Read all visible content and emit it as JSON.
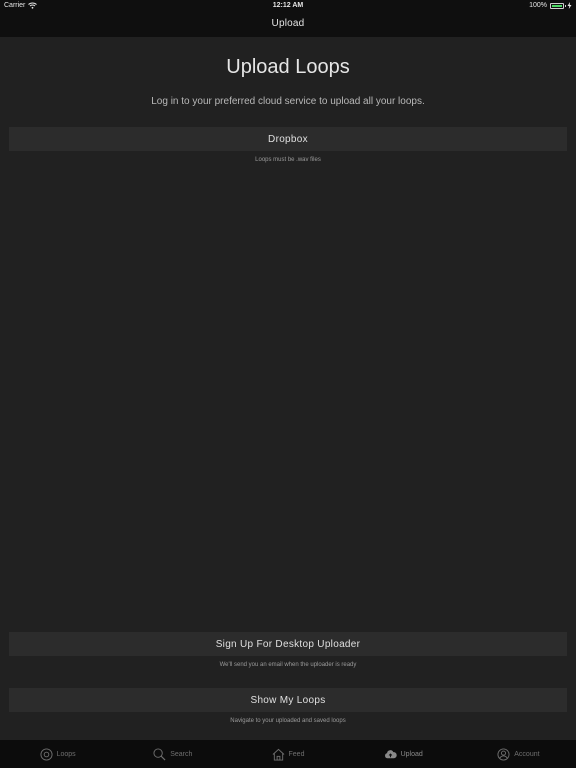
{
  "status": {
    "carrier": "Carrier",
    "time": "12:12 AM",
    "battery": "100%",
    "battery_level": 1.0
  },
  "nav": {
    "title": "Upload"
  },
  "main": {
    "title": "Upload Loops",
    "subtitle": "Log in to your preferred cloud service to upload all your loops.",
    "dropbox": {
      "label": "Dropbox",
      "note": "Loops must be .wav files"
    },
    "desktop": {
      "label": "Sign Up For Desktop Uploader",
      "note": "We'll send you an email when the uploader is ready"
    },
    "myloops": {
      "label": "Show My Loops",
      "note": "Navigate to your uploaded and saved loops"
    }
  },
  "tabs": [
    {
      "label": "Loops",
      "icon": "loops-icon"
    },
    {
      "label": "Search",
      "icon": "search-icon"
    },
    {
      "label": "Feed",
      "icon": "home-icon"
    },
    {
      "label": "Upload",
      "icon": "cloud-upload-icon",
      "active": true
    },
    {
      "label": "Account",
      "icon": "account-icon"
    }
  ],
  "colors": {
    "background": "#212121",
    "bar": "#0f0f0f",
    "button": "#2c2c2c",
    "battery": "#4cd964"
  }
}
